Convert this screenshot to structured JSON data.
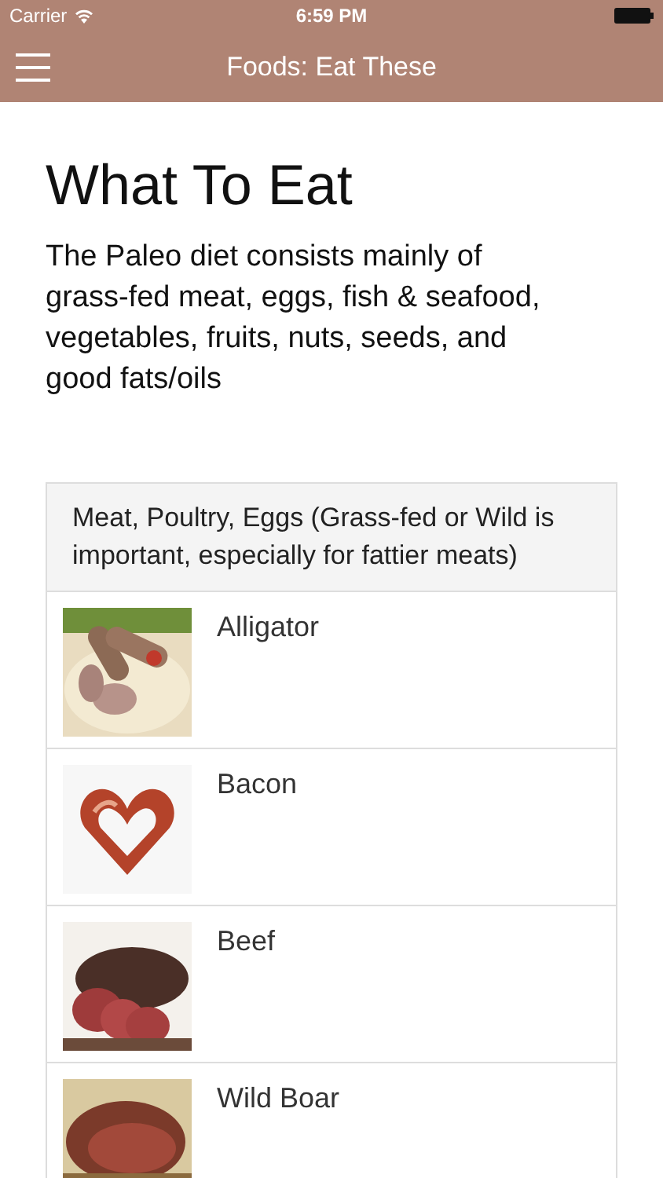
{
  "status_bar": {
    "carrier": "Carrier",
    "time": "6:59 PM"
  },
  "nav_bar": {
    "title": "Foods: Eat These"
  },
  "heading": "What To Eat",
  "intro": "The Paleo diet consists mainly of grass-fed meat, eggs, fish & seafood, vegetables, fruits, nuts, seeds, and good fats/oils",
  "section": {
    "header": "Meat, Poultry, Eggs (Grass-fed or Wild is important, especially for fattier meats)",
    "items": [
      {
        "name": "Alligator"
      },
      {
        "name": "Bacon"
      },
      {
        "name": "Beef"
      },
      {
        "name": "Wild Boar"
      }
    ]
  }
}
